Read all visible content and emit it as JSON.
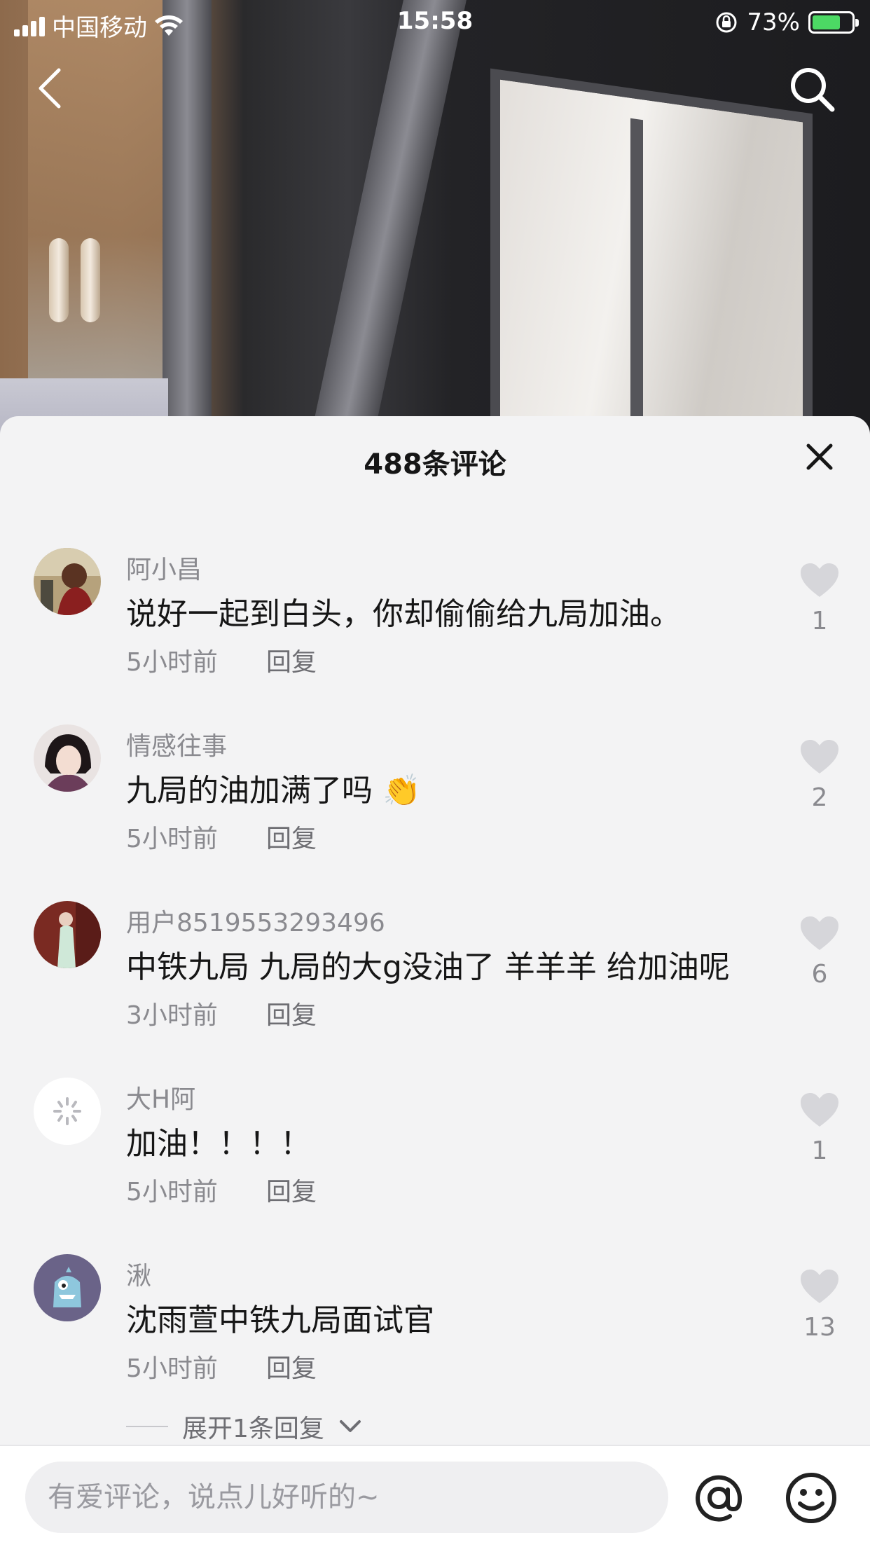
{
  "status_bar": {
    "carrier": "中国移动",
    "time": "15:58",
    "battery": "73%",
    "battery_level": 0.73
  },
  "sheet": {
    "title": "488条评论"
  },
  "comments": [
    {
      "name": "阿小昌",
      "text": "说好一起到白头，你却偷偷给九局加油。",
      "time": "5小时前",
      "reply": "回复",
      "likes": "1"
    },
    {
      "name": "情感往事",
      "text": "九局的油加满了吗 👏",
      "time": "5小时前",
      "reply": "回复",
      "likes": "2"
    },
    {
      "name": "用户8519553293496",
      "text": "中铁九局 九局的大g没油了 羊羊羊 给加油呢",
      "time": "3小时前",
      "reply": "回复",
      "likes": "6"
    },
    {
      "name": "大H阿",
      "text": "加油！！！！",
      "time": "5小时前",
      "reply": "回复",
      "likes": "1"
    },
    {
      "name": "湫",
      "text": "沈雨萱中铁九局面试官",
      "time": "5小时前",
      "reply": "回复",
      "likes": "13"
    }
  ],
  "expand_replies": "展开1条回复",
  "input": {
    "placeholder": "有爱评论，说点儿好听的~",
    "value": ""
  },
  "icons": {
    "back": "chevron-left-icon",
    "search": "search-icon",
    "close": "close-icon",
    "like": "heart-icon",
    "mention": "at-icon",
    "emoji": "emoji-icon"
  },
  "colors": {
    "sheet_bg": "#f3f3f4",
    "text_primary": "#161616",
    "text_secondary": "#8a8a8f",
    "heart": "#d6d6da",
    "battery": "#4cd964"
  }
}
